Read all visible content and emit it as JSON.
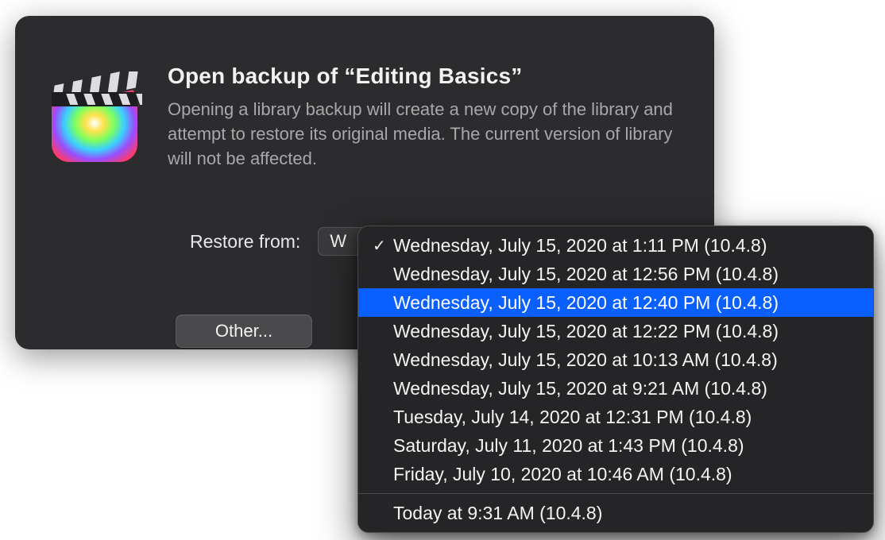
{
  "dialog": {
    "title": "Open backup of “Editing Basics”",
    "subtitle": "Opening a library backup will create a new copy of the library and attempt to restore its original media. The current version of library will not be affected.",
    "restore_label": "Restore from:",
    "popup_selected_preview": "W",
    "other_button": "Other...",
    "icon_name": "final-cut-pro-icon"
  },
  "menu": {
    "selected_index": 0,
    "highlighted_index": 2,
    "items": [
      {
        "label": "Wednesday, July 15, 2020 at 1:11 PM (10.4.8)"
      },
      {
        "label": "Wednesday, July 15, 2020 at 12:56 PM (10.4.8)"
      },
      {
        "label": "Wednesday, July 15, 2020 at 12:40 PM (10.4.8)"
      },
      {
        "label": "Wednesday, July 15, 2020 at 12:22 PM (10.4.8)"
      },
      {
        "label": "Wednesday, July 15, 2020 at 10:13 AM (10.4.8)"
      },
      {
        "label": "Wednesday, July 15, 2020 at 9:21 AM (10.4.8)"
      },
      {
        "label": "Tuesday, July 14, 2020 at 12:31 PM (10.4.8)"
      },
      {
        "label": "Saturday, July 11, 2020 at 1:43 PM (10.4.8)"
      },
      {
        "label": "Friday, July 10, 2020 at 10:46 AM (10.4.8)"
      }
    ],
    "separator_after_index": 8,
    "items_after": [
      {
        "label": "Today at 9:31 AM (10.4.8)"
      }
    ]
  }
}
